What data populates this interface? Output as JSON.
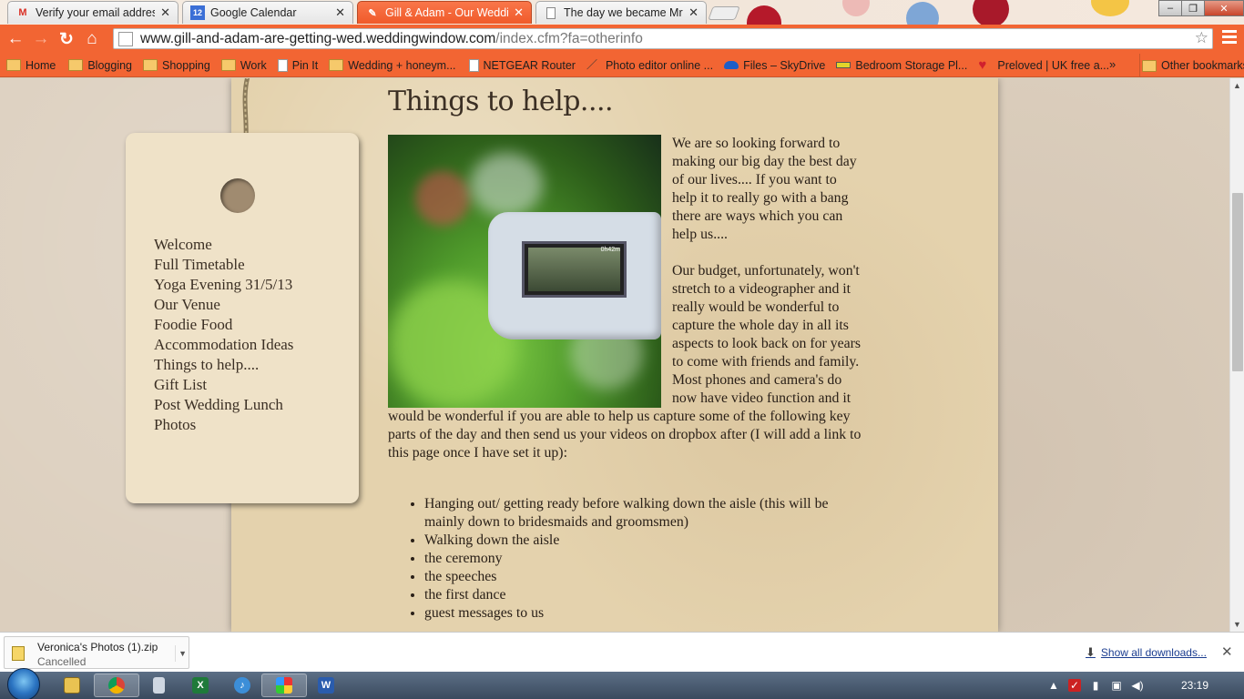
{
  "browser": {
    "tabs": [
      {
        "title": "Verify your email address",
        "favicon": "gmail-icon",
        "active": false
      },
      {
        "title": "Google Calendar",
        "favicon": "calendar-icon",
        "favicon_text": "12",
        "active": false
      },
      {
        "title": "Gill & Adam - Our Weddin",
        "favicon": "weddingwindow-icon",
        "active": true
      },
      {
        "title": "The day we became Mr &",
        "favicon": "page-icon",
        "active": false
      }
    ],
    "url_domain": "www.gill-and-adam-are-getting-wed.weddingwindow.com",
    "url_path": "/index.cfm?fa=otherinfo",
    "bookmarks": [
      {
        "label": "Home",
        "icon": "folder-icon"
      },
      {
        "label": "Blogging",
        "icon": "folder-icon"
      },
      {
        "label": "Shopping",
        "icon": "folder-icon"
      },
      {
        "label": "Work",
        "icon": "folder-icon"
      },
      {
        "label": "Pin It",
        "icon": "page-icon"
      },
      {
        "label": "Wedding + honeym...",
        "icon": "folder-icon"
      },
      {
        "label": "NETGEAR Router",
        "icon": "page-icon"
      },
      {
        "label": "Photo editor online ...",
        "icon": "brush-icon"
      },
      {
        "label": "Files – SkyDrive",
        "icon": "skydrive-icon"
      },
      {
        "label": "Bedroom Storage Pl...",
        "icon": "tape-icon"
      },
      {
        "label": "Preloved | UK free a...",
        "icon": "heart-icon"
      }
    ],
    "other_bookmarks": "Other bookmarks",
    "chevron": "»"
  },
  "page": {
    "heading": "Things to help....",
    "nav": [
      "Welcome",
      "Full Timetable",
      "Yoga Evening 31/5/13",
      "Our Venue",
      "Foodie Food",
      "Accommodation Ideas",
      "Things to help....",
      "Gift List",
      "Post Wedding Lunch",
      "Photos"
    ],
    "paragraph1": "We are so looking forward to making our big day the best day of our lives.... If you want to help it to really go with a bang there are ways which you can help us....",
    "paragraph2": "Our budget, unfortunately, won't stretch to a videographer and it really would be wonderful to capture the whole day in all its aspects to look back on for years to come with friends and family. Most phones and camera's do now have video function and it would be wonderful if you are able to help us capture some of the following key parts of the day and then send us your videos on dropbox after (I will add a link to this page once I have set it up):",
    "bullets": [
      "Hanging out/ getting ready before walking down the aisle (this will be mainly down to bridesmaids and groomsmen)",
      "Walking down the aisle",
      "the ceremony",
      "the speeches",
      "the first dance",
      "guest messages to us"
    ],
    "camera_screen_text": "0h42m"
  },
  "downloads": {
    "file_name": "Veronica's Photos (1).zip",
    "status": "Cancelled",
    "show_all": "Show all downloads..."
  },
  "taskbar": {
    "apps": [
      "explorer-icon",
      "chrome-icon",
      "calculator-icon",
      "excel-icon",
      "itunes-icon",
      "paint-icon",
      "word-icon"
    ],
    "clock": "23:19"
  },
  "colors": {
    "chrome_accent": "#f26533",
    "paper": "#e4d2ad",
    "tag": "#efe2c8",
    "text": "#2a2018"
  }
}
